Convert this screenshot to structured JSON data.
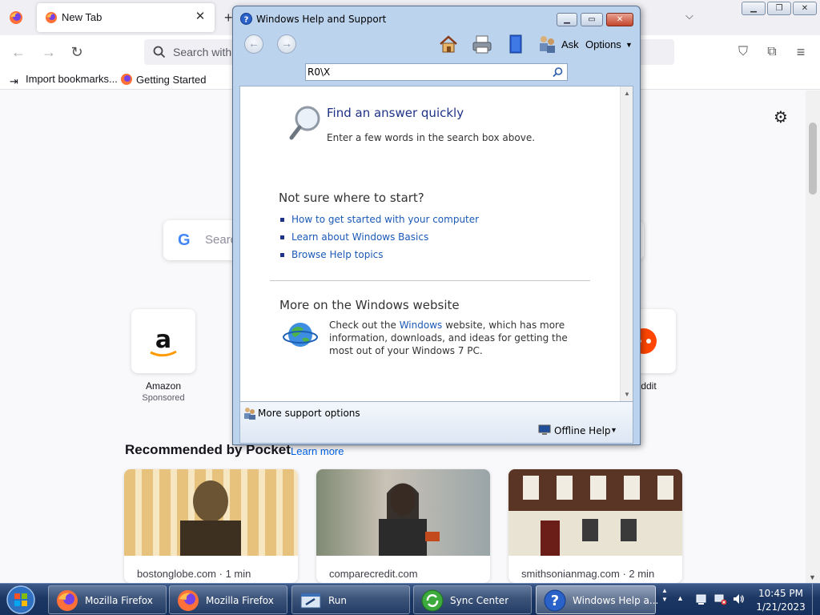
{
  "firefox": {
    "tab_title": "New Tab",
    "urlbar_placeholder": "Search with",
    "bookmarks": [
      "Import bookmarks...",
      "Getting Started"
    ],
    "content": {
      "search_placeholder": "Searc",
      "shortcuts": [
        {
          "label": "Amazon",
          "sub": "Sponsored"
        },
        {
          "label": "ddit"
        }
      ],
      "pocket_title": "Recommended by Pocket",
      "pocket_learn_more": "Learn more",
      "pocket_cards": [
        {
          "source": "bostonglobe.com · 1 min"
        },
        {
          "source": "comparecredit.com"
        },
        {
          "source": "smithsonianmag.com · 2 min"
        }
      ]
    }
  },
  "help": {
    "title": "Windows Help and Support",
    "toolbar": {
      "ask": "Ask",
      "options": "Options"
    },
    "search_value": "R0\\X",
    "find_heading": "Find an answer quickly",
    "find_desc": "Enter a few words in the search box above.",
    "notsure_heading": "Not sure where to start?",
    "links": [
      "How to get started with your computer",
      "Learn about Windows Basics",
      "Browse Help topics"
    ],
    "more_heading": "More on the Windows website",
    "more_text_before": "Check out the ",
    "more_link": "Windows",
    "more_text_after": " website, which has more information, downloads, and ideas for getting the most out of your Windows 7 PC.",
    "more_support": "More support options",
    "offline_help": "Offline Help"
  },
  "taskbar": {
    "tasks": [
      {
        "label": "Mozilla Firefox",
        "icon": "firefox-icon"
      },
      {
        "label": "Mozilla Firefox",
        "icon": "firefox-icon"
      },
      {
        "label": "Run",
        "icon": "run-icon"
      },
      {
        "label": "Sync Center",
        "icon": "sync-center-icon"
      },
      {
        "label": "Windows Help a...",
        "icon": "help-icon"
      }
    ],
    "time": "10:45 PM",
    "date": "1/21/2023"
  }
}
